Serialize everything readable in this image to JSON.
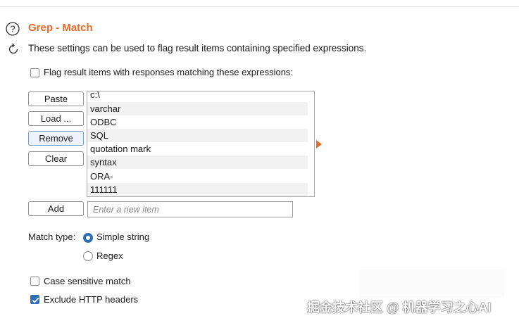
{
  "section": {
    "title": "Grep - Match",
    "description": "These settings can be used to flag result items containing specified expressions."
  },
  "flag_checkbox": {
    "label": "Flag result items with responses matching these expressions:",
    "checked": false
  },
  "buttons": {
    "paste": "Paste",
    "load": "Load ...",
    "remove": "Remove",
    "clear": "Clear",
    "add": "Add"
  },
  "expressions": [
    "c:\\",
    "varchar",
    "ODBC",
    "SQL",
    "quotation mark",
    "syntax",
    "ORA-",
    "111111"
  ],
  "new_item": {
    "placeholder": "Enter a new item",
    "value": ""
  },
  "match_type": {
    "label": "Match type:",
    "options": [
      "Simple string",
      "Regex"
    ],
    "selected": "Simple string"
  },
  "options": {
    "case_sensitive": {
      "label": "Case sensitive match",
      "checked": false
    },
    "exclude_headers": {
      "label": "Exclude HTTP headers",
      "checked": true
    }
  },
  "colors": {
    "accent": "#e36b2c",
    "selection": "#2f6fb8"
  },
  "icons": {
    "help": "help-icon",
    "refresh": "refresh-icon"
  },
  "watermark": "掘金技术社区 @ 机器学习之心AI"
}
